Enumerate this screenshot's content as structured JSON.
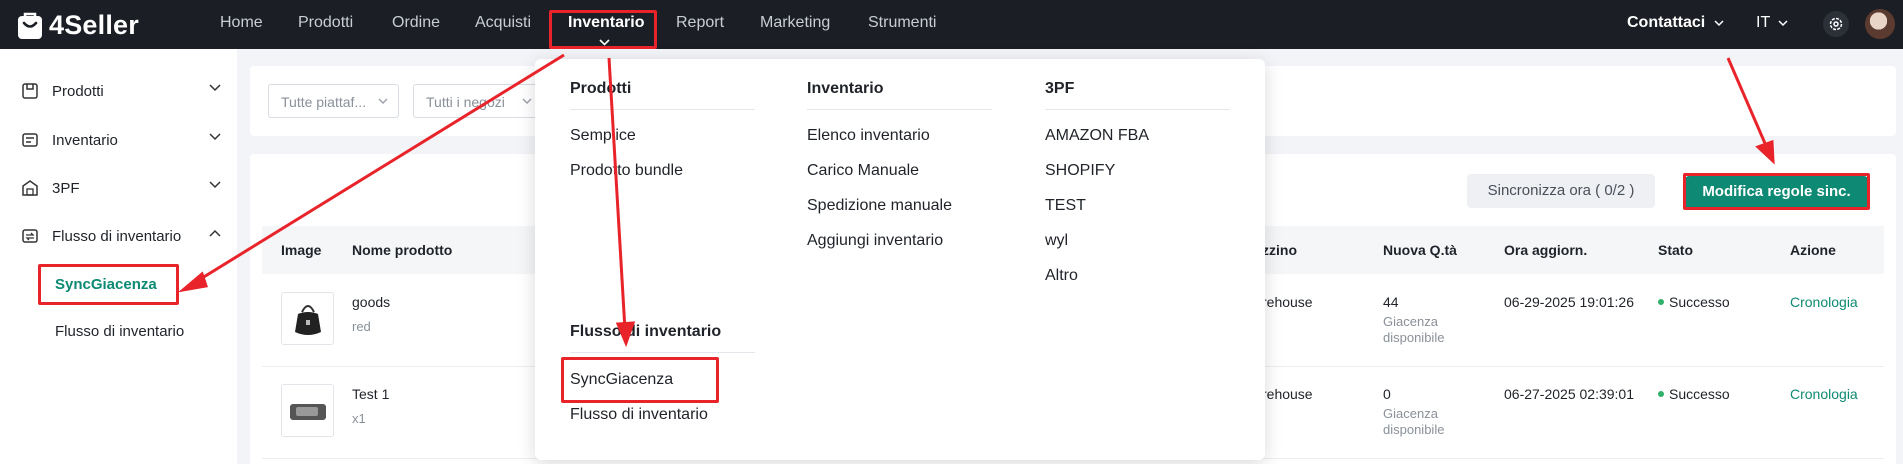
{
  "brand": {
    "name": "4Seller"
  },
  "topnav": {
    "items": [
      "Home",
      "Prodotti",
      "Ordine",
      "Acquisti",
      "Inventario",
      "Report",
      "Marketing",
      "Strumenti"
    ],
    "contact": "Contattaci",
    "language": "IT"
  },
  "sidebar": {
    "items": [
      {
        "label": "Prodotti",
        "icon": "box-icon"
      },
      {
        "label": "Inventario",
        "icon": "inventory-icon"
      },
      {
        "label": "3PF",
        "icon": "warehouse-icon"
      },
      {
        "label": "Flusso di inventario",
        "icon": "flow-icon"
      }
    ],
    "subitems": [
      "SyncGiacenza",
      "Flusso di inventario"
    ]
  },
  "filters": {
    "platform_placeholder": "Tutte piattaf...",
    "store_placeholder": "Tutti i negozi"
  },
  "actions": {
    "sync_label": "Sincronizza ora ( 0/2 )",
    "modify_label": "Modifica regole sinc."
  },
  "table": {
    "headers": [
      "Image",
      "Nome prodotto",
      "zzino",
      "Nuova Q.tà",
      "Ora aggiorn.",
      "Stato",
      "Azione"
    ],
    "rows": [
      {
        "name": "goods",
        "variant": "red",
        "warehouse": "rehouse",
        "qty": "44",
        "qty_note": "Giacenza disponibile",
        "updated": "06-29-2025 19:01:26",
        "status": "Successo",
        "action": "Cronologia"
      },
      {
        "name": "Test 1",
        "variant": "x1",
        "warehouse": "rehouse",
        "qty": "0",
        "qty_note": "Giacenza disponibile",
        "updated": "06-27-2025 02:39:01",
        "status": "Successo",
        "action": "Cronologia"
      }
    ]
  },
  "dropdown": {
    "prodotti": {
      "title": "Prodotti",
      "items": [
        "Semplice",
        "Prodotto bundle"
      ]
    },
    "inventario": {
      "title": "Inventario",
      "items": [
        "Elenco inventario",
        "Carico Manuale",
        "Spedizione manuale",
        "Aggiungi inventario"
      ]
    },
    "tpf": {
      "title": "3PF",
      "items": [
        "AMAZON FBA",
        "SHOPIFY",
        "TEST",
        "wyl",
        "Altro"
      ]
    },
    "flusso": {
      "title": "Flusso di inventario",
      "items": [
        "SyncGiacenza",
        "Flusso di inventario"
      ]
    }
  },
  "colors": {
    "accent": "#0e8a74",
    "nav_bg": "#1b1e24",
    "annotation": "#e8242a"
  }
}
